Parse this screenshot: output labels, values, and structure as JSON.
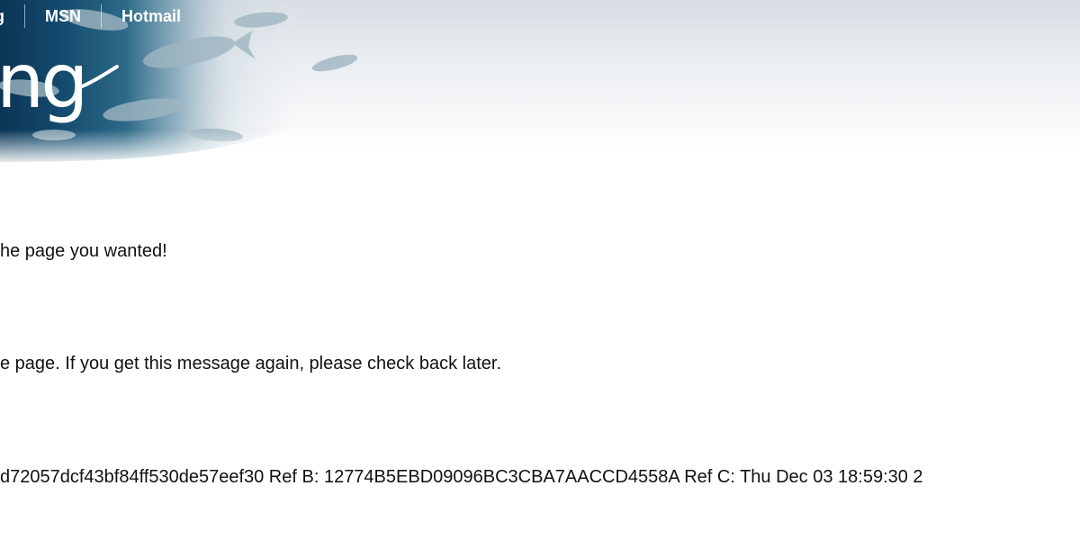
{
  "header": {
    "nav_items": [
      "g",
      "MSN",
      "Hotmail"
    ],
    "logo_text": "ng"
  },
  "main": {
    "message_1": "he page you wanted!",
    "message_2": "e page. If you get this message again, please check back later.",
    "reference_line": "d72057dcf43bf84ff530de57eef30 Ref B: 12774B5EBD09096BC3CBA7AACCD4558A Ref C: Thu Dec 03 18:59:30 2"
  }
}
